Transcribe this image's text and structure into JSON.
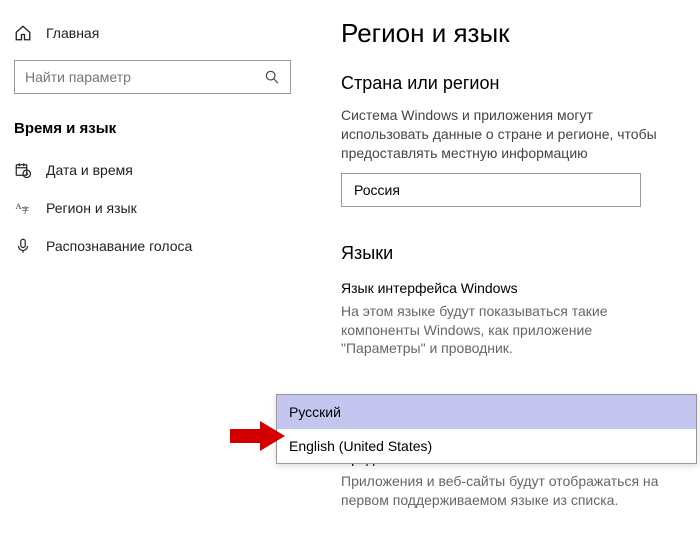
{
  "sidebar": {
    "home": "Главная",
    "search_placeholder": "Найти параметр",
    "section": "Время и язык",
    "items": [
      {
        "label": "Дата и время"
      },
      {
        "label": "Регион и язык"
      },
      {
        "label": "Распознавание голоса"
      }
    ]
  },
  "main": {
    "title": "Регион и язык",
    "region": {
      "heading": "Страна или регион",
      "desc": "Система Windows и приложения могут использовать данные о стране и регионе, чтобы предоставлять местную информацию",
      "value": "Россия"
    },
    "languages": {
      "heading": "Языки",
      "sub_heading": "Язык интерфейса Windows",
      "desc": "На этом языке будут показываться такие компоненты Windows, как приложение \"Параметры\" и проводник.",
      "dropdown_options": [
        "Русский",
        "English (United States)"
      ],
      "preferred_heading": "Предпочитаемые языки",
      "preferred_desc": "Приложения и веб-сайты будут отображаться на первом поддерживаемом языке из списка."
    }
  }
}
